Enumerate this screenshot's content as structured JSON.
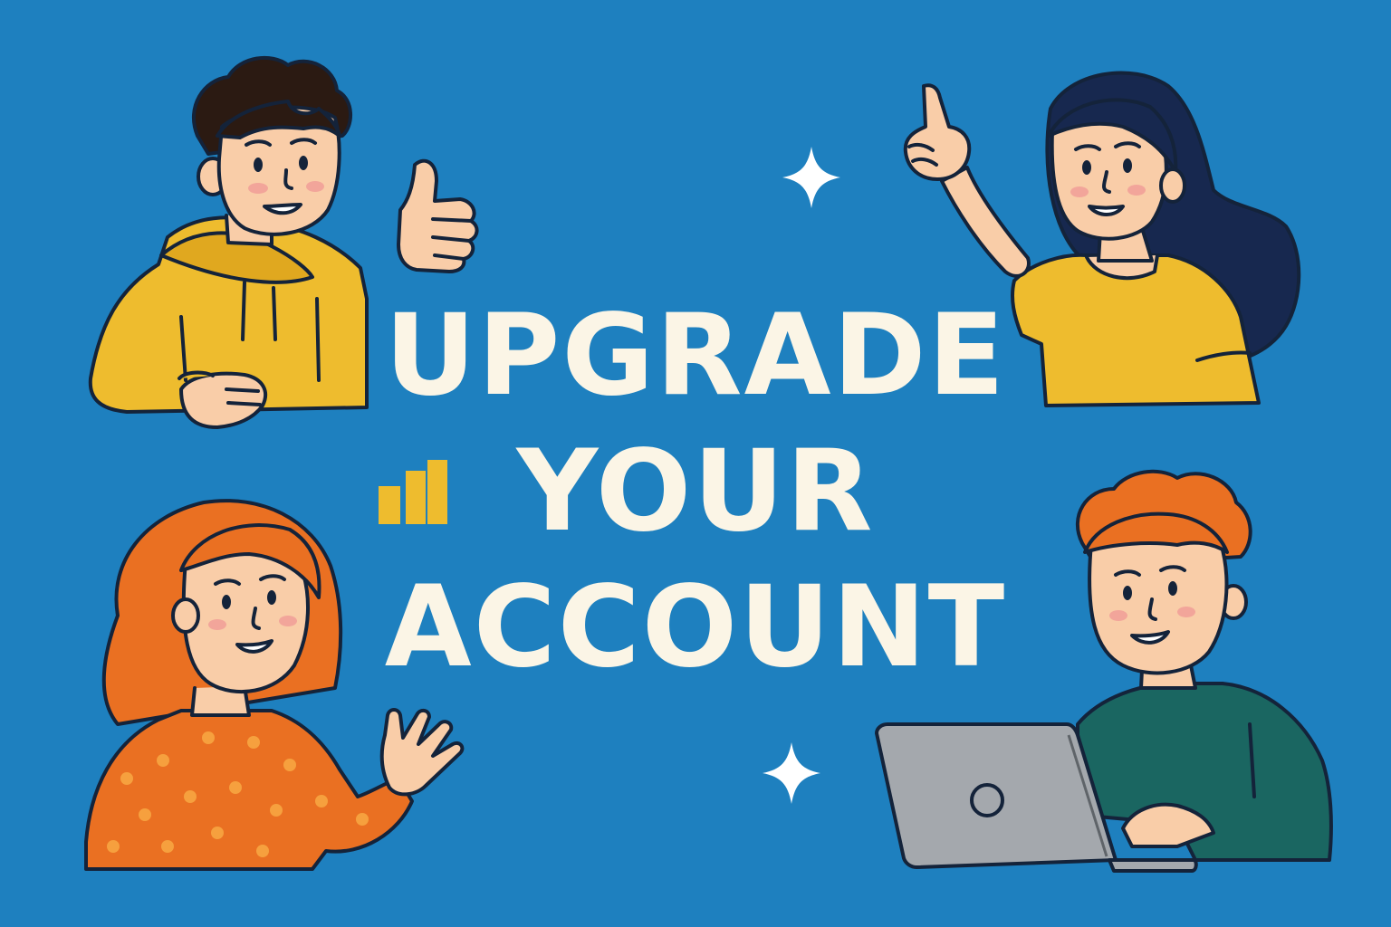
{
  "headline": {
    "line1": "UPGRADE",
    "line2": "YOUR",
    "line3": "ACCOUNT"
  },
  "colors": {
    "background": "#1e80bf",
    "headline_text": "#fbf5e6",
    "outline": "#14233a",
    "skin": "#f9cda8",
    "mustard": "#eebc2e",
    "orange": "#ea7022",
    "teal": "#1a6661",
    "navy_hair": "#17284f",
    "dark_hair": "#2b1a12",
    "laptop_gray": "#a4a8ad"
  },
  "illustration": {
    "people": [
      {
        "name": "person-thumbs-up",
        "hair": "dark curly",
        "top": "mustard hoodie"
      },
      {
        "name": "person-pointing-up",
        "hair": "navy long",
        "top": "mustard tee"
      },
      {
        "name": "person-waving",
        "hair": "orange",
        "top": "orange polka-dot sweater"
      },
      {
        "name": "person-with-laptop",
        "hair": "orange curly",
        "top": "teal sweater"
      }
    ],
    "decorations": [
      "sparkle-icon",
      "sparkle-icon",
      "bar-chart-icon"
    ]
  }
}
